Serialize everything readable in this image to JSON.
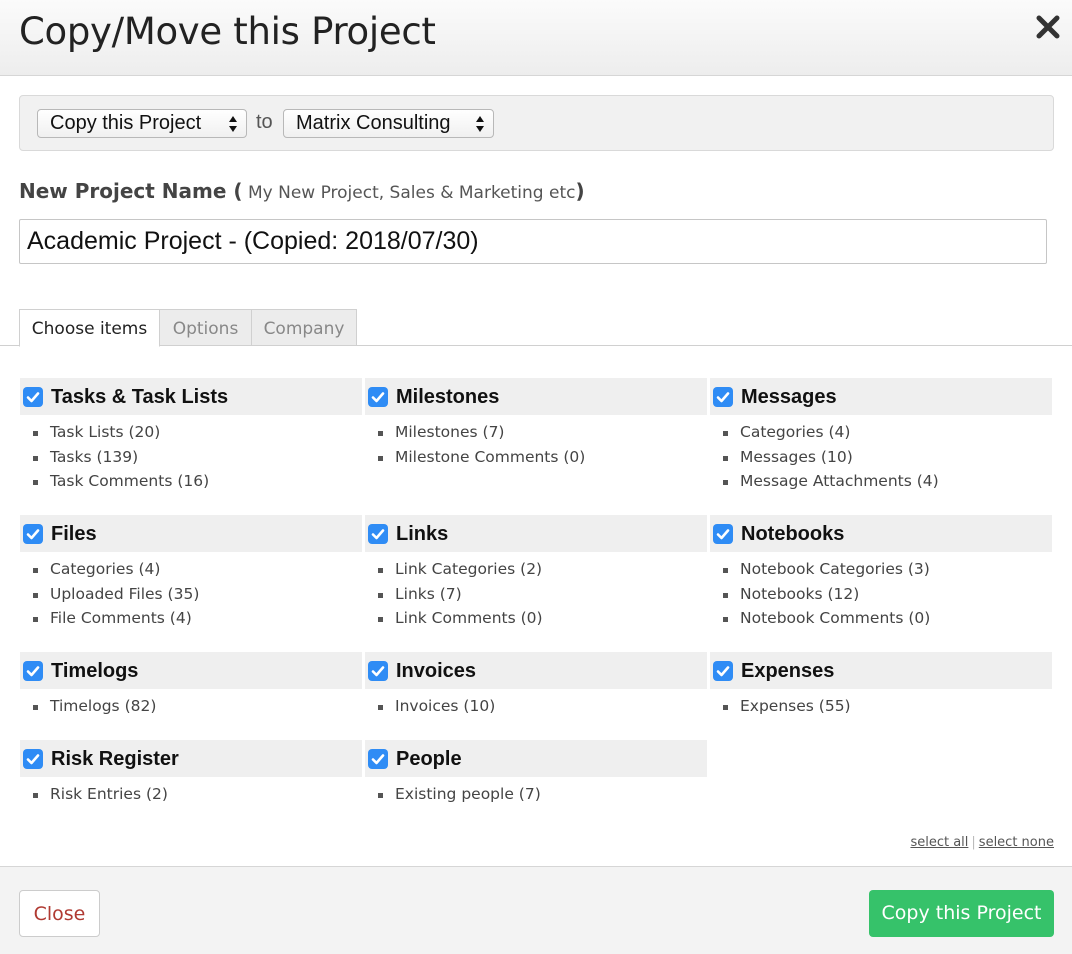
{
  "dialog": {
    "title": "Copy/Move this Project",
    "close_icon": "close-icon"
  },
  "mode_bar": {
    "mode_selected": "Copy this Project",
    "to_label": "to",
    "company_selected": "Matrix Consulting"
  },
  "project_name": {
    "label": "New Project Name",
    "hint_open": "(",
    "hint": " My New Project, Sales & Marketing etc",
    "hint_close": ")",
    "value": "Academic Project - (Copied: 2018/07/30)"
  },
  "tabs": [
    {
      "label": "Choose items",
      "active": true
    },
    {
      "label": "Options",
      "active": false
    },
    {
      "label": "Company",
      "active": false
    }
  ],
  "groups": [
    {
      "title": "Tasks & Task Lists",
      "checked": true,
      "items": [
        "Task Lists (20)",
        "Tasks (139)",
        "Task Comments (16)"
      ]
    },
    {
      "title": "Milestones",
      "checked": true,
      "items": [
        "Milestones (7)",
        "Milestone Comments (0)"
      ]
    },
    {
      "title": "Messages",
      "checked": true,
      "items": [
        "Categories (4)",
        "Messages (10)",
        "Message Attachments (4)"
      ]
    },
    {
      "title": "Files",
      "checked": true,
      "items": [
        "Categories (4)",
        "Uploaded Files (35)",
        "File Comments (4)"
      ]
    },
    {
      "title": "Links",
      "checked": true,
      "items": [
        "Link Categories (2)",
        "Links (7)",
        "Link Comments (0)"
      ]
    },
    {
      "title": "Notebooks",
      "checked": true,
      "items": [
        "Notebook Categories (3)",
        "Notebooks (12)",
        "Notebook Comments (0)"
      ]
    },
    {
      "title": "Timelogs",
      "checked": true,
      "items": [
        "Timelogs (82)"
      ]
    },
    {
      "title": "Invoices",
      "checked": true,
      "items": [
        "Invoices (10)"
      ]
    },
    {
      "title": "Expenses",
      "checked": true,
      "items": [
        "Expenses (55)"
      ]
    },
    {
      "title": "Risk Register",
      "checked": true,
      "items": [
        "Risk Entries (2)"
      ]
    },
    {
      "title": "People",
      "checked": true,
      "items": [
        "Existing people (7)"
      ]
    }
  ],
  "selection": {
    "select_all": "select all",
    "separator": "|",
    "select_none": "select none"
  },
  "footer": {
    "close_label": "Close",
    "copy_label": "Copy this Project"
  },
  "colors": {
    "checkbox": "#2f8cf5",
    "primary_button": "#36c26a",
    "close_text": "#b03a32"
  }
}
